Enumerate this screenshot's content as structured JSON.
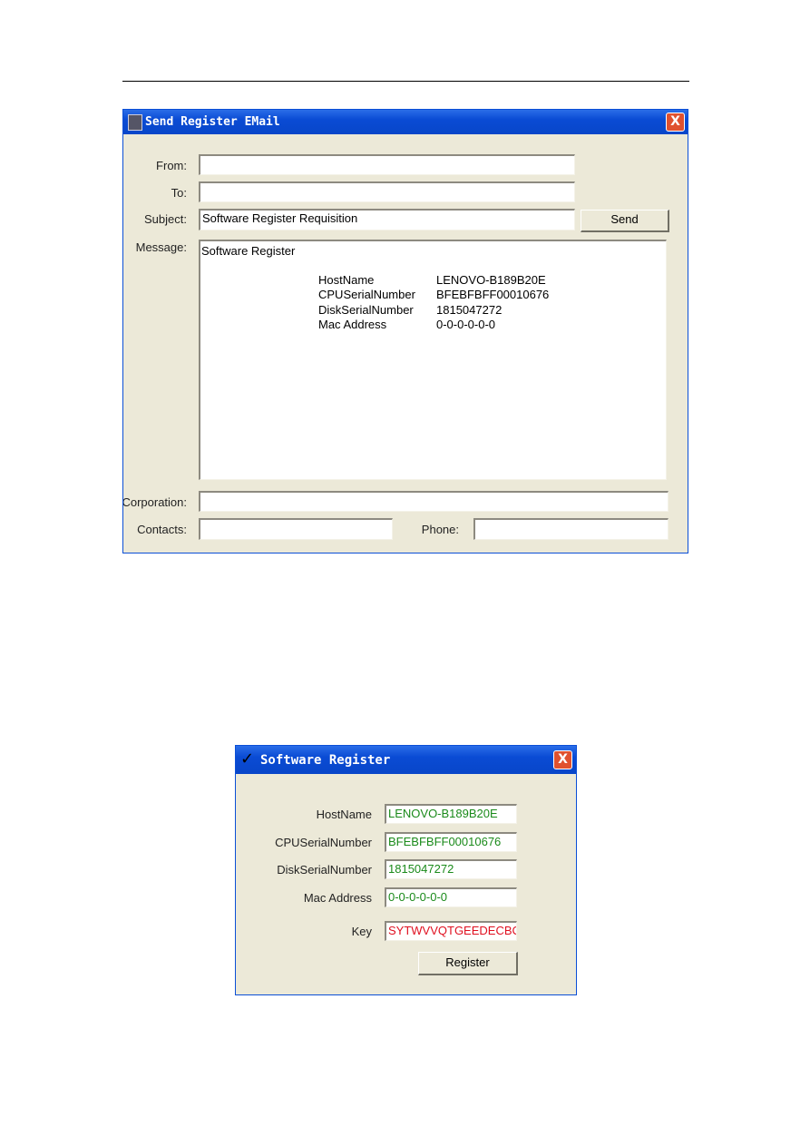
{
  "email_dialog": {
    "title": "Send Register EMail",
    "close": "X",
    "from_label": "From:",
    "from_value": "",
    "to_label": "To:",
    "to_value": "",
    "subject_label": "Subject:",
    "subject_value": "Software Register Requisition",
    "send_label": "Send",
    "message_label": "Message:",
    "message": {
      "heading": "Software Register",
      "rows": [
        {
          "k": "HostName",
          "v": "LENOVO-B189B20E"
        },
        {
          "k": "CPUSerialNumber",
          "v": "BFEBFBFF00010676"
        },
        {
          "k": "DiskSerialNumber",
          "v": "1815047272"
        },
        {
          "k": "Mac Address",
          "v": "0-0-0-0-0-0"
        }
      ]
    },
    "corporation_label": "Corporation:",
    "corporation_value": "",
    "contacts_label": "Contacts:",
    "contacts_value": "",
    "phone_label": "Phone:",
    "phone_value": ""
  },
  "register_dialog": {
    "title": "Software Register",
    "close": "X",
    "fields": [
      {
        "label": "HostName",
        "value": "LENOVO-B189B20E"
      },
      {
        "label": "CPUSerialNumber",
        "value": "BFEBFBFF00010676"
      },
      {
        "label": "DiskSerialNumber",
        "value": "1815047272"
      },
      {
        "label": "Mac Address",
        "value": "0-0-0-0-0-0"
      },
      {
        "label": "Key",
        "value": "SYTWVVQTGEEDECBC"
      }
    ],
    "register_label": "Register",
    "value_color": "#1a8a1a",
    "key_color": "#e01020"
  }
}
